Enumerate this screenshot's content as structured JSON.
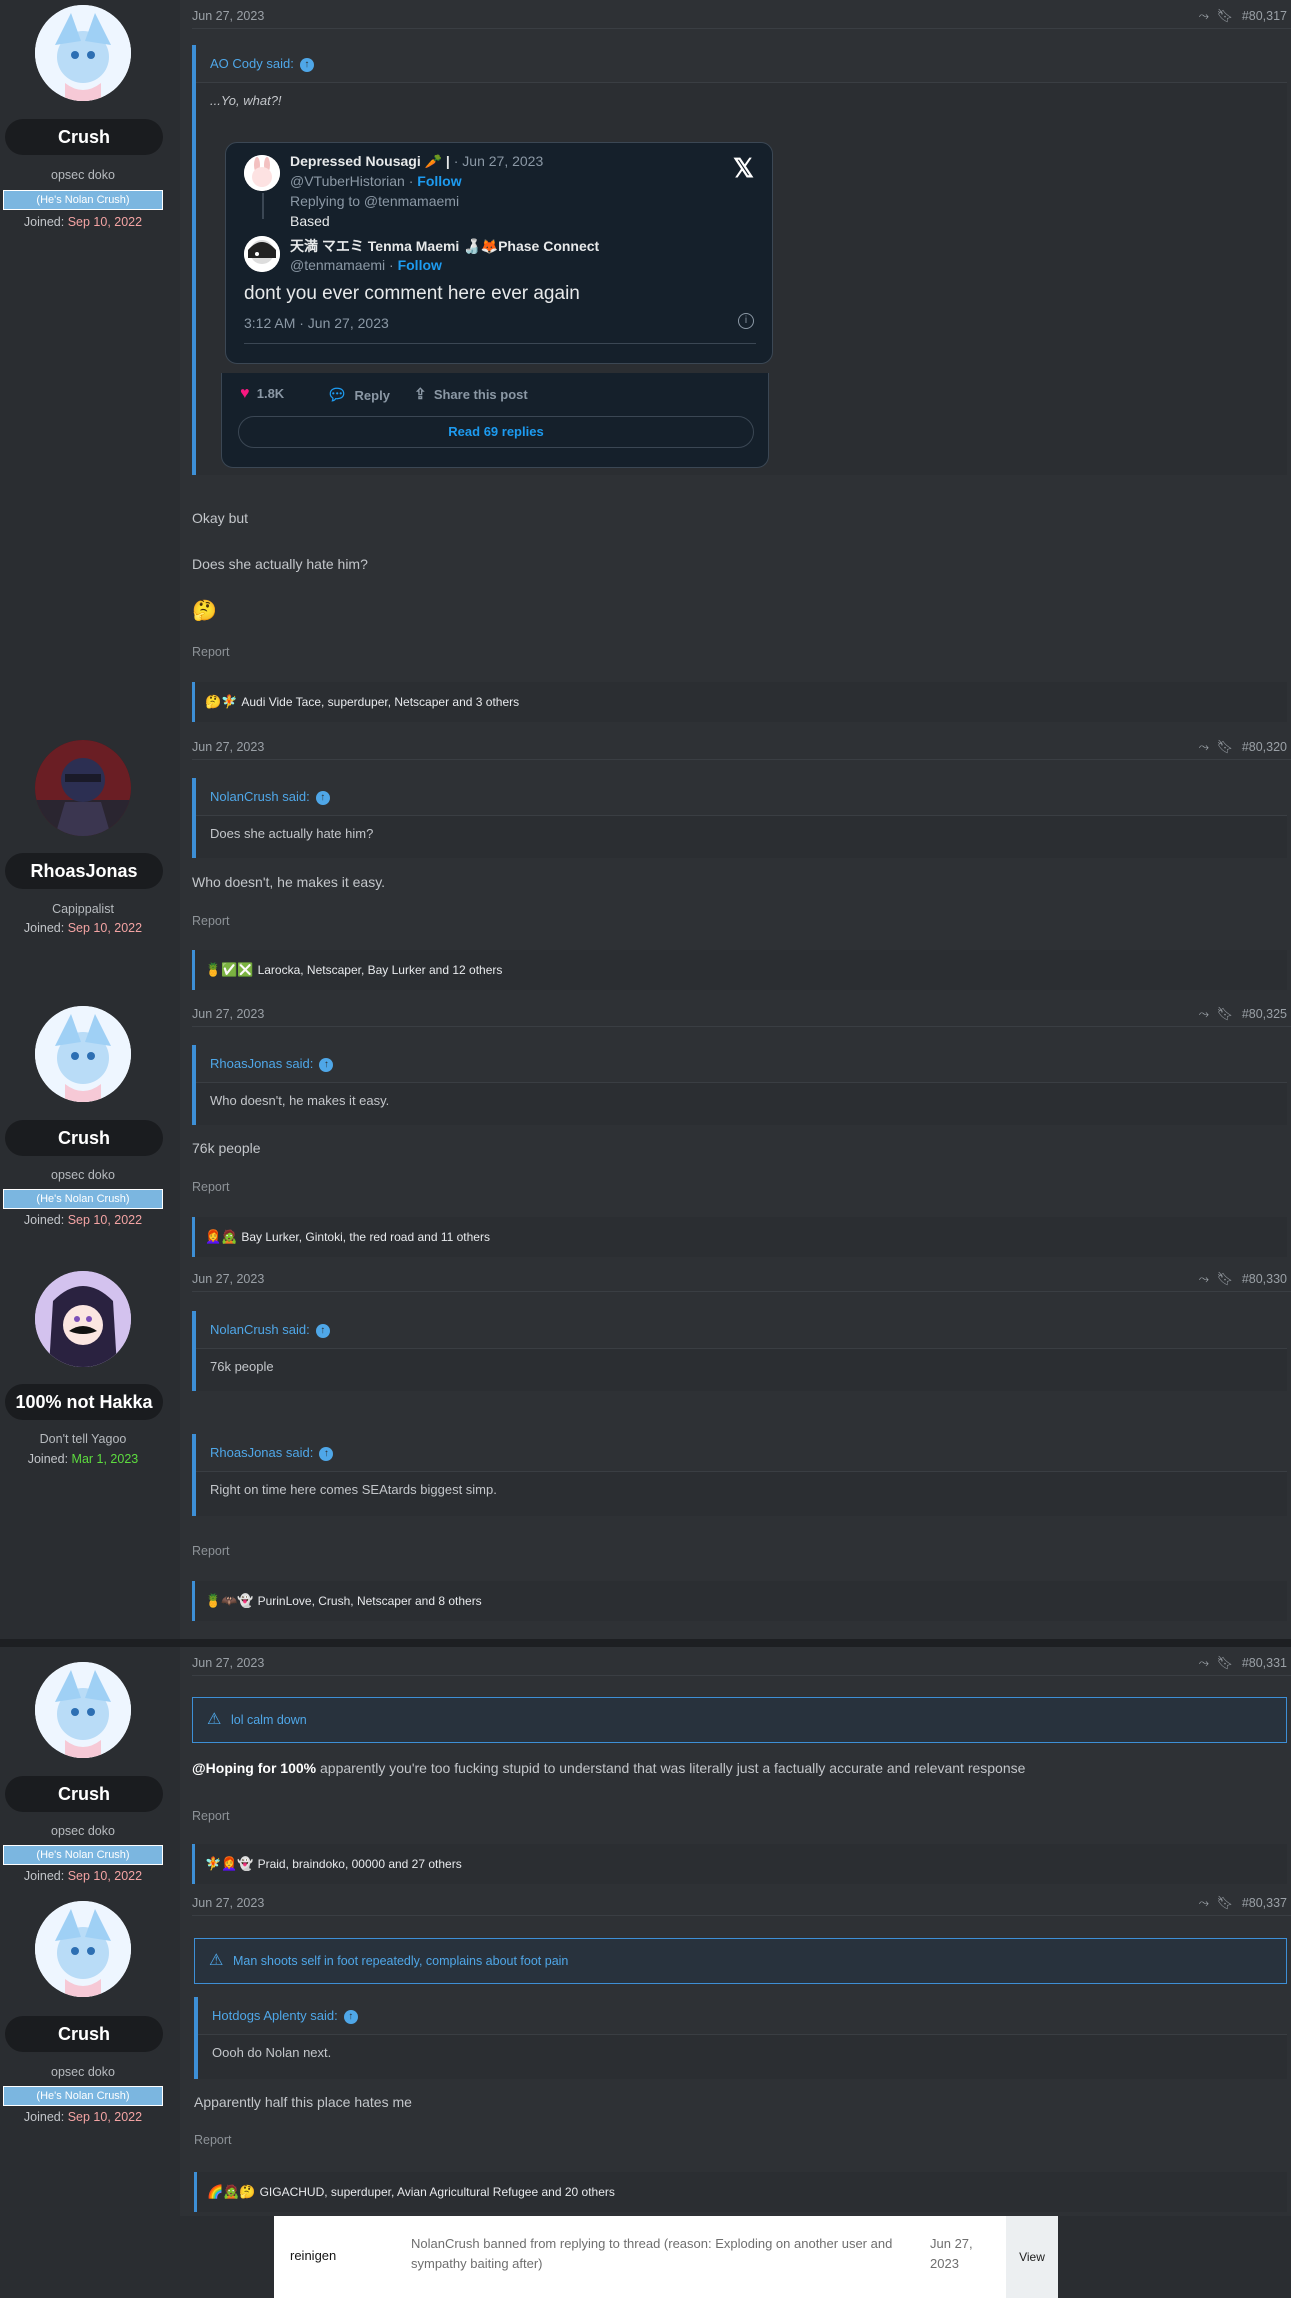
{
  "posts": [
    {
      "user": {
        "name": "Crush",
        "title": "opsec doko",
        "banner": "(He's Nolan Crush)",
        "joined_label": "Joined:",
        "joined": "Sep 10, 2022"
      },
      "date": "Jun 27, 2023",
      "number": "#80,317",
      "quote_author": "AO Cody said:",
      "quote_text": "...Yo, what?!",
      "tweet": {
        "name": "Depressed Nousagi 🥕 |",
        "date": "· Jun 27, 2023",
        "handle": "@VTuberHistorian ·",
        "follow": "Follow",
        "replying": "Replying to @tenmamaemi",
        "reply_text": "Based",
        "name2": "天満 マエミ Tenma Maemi 🍶🦊Phase Connect",
        "handle2": "@tenmamaemi ·",
        "main_text": "dont you ever comment here ever again",
        "time": "3:12 AM · Jun 27, 2023",
        "likes": "1.8K",
        "reply_label": "Reply",
        "share_label": "Share this post",
        "read_replies": "Read 69 replies"
      },
      "body": [
        "Okay but",
        "Does she actually hate him?",
        "🤔"
      ],
      "report": "Report",
      "reactions_emoji": "🤔🧚",
      "reactions": "Audi Vide Tace, superduper, Netscaper and 3 others"
    },
    {
      "user": {
        "name": "RhoasJonas",
        "title": "Capippalist",
        "joined_label": "Joined:",
        "joined": "Sep 10, 2022"
      },
      "date": "Jun 27, 2023",
      "number": "#80,320",
      "quote_author": "NolanCrush said:",
      "quote_text": "Does she actually hate him?",
      "body": "Who doesn't, he makes it easy.",
      "report": "Report",
      "reactions_emoji": "🍍✅❎",
      "reactions": "Larocka, Netscaper, Bay Lurker and 12 others"
    },
    {
      "user": {
        "name": "Crush",
        "title": "opsec doko",
        "banner": "(He's Nolan Crush)",
        "joined_label": "Joined:",
        "joined": "Sep 10, 2022"
      },
      "date": "Jun 27, 2023",
      "number": "#80,325",
      "quote_author": "RhoasJonas said:",
      "quote_text": "Who doesn't, he makes it easy.",
      "body": "76k people",
      "report": "Report",
      "reactions_emoji": "👩‍🦰🧟",
      "reactions": "Bay Lurker, Gintoki, the red road and 11 others"
    },
    {
      "user": {
        "name": "100% not Hakka",
        "title": "Don't tell Yagoo",
        "joined_label": "Joined:",
        "joined": "Mar 1, 2023"
      },
      "date": "Jun 27, 2023",
      "number": "#80,330",
      "quote_author": "NolanCrush said:",
      "quote_text": "76k people",
      "quote2_author": "RhoasJonas said:",
      "quote2_text": "Right on time here comes SEAtards biggest simp.",
      "report": "Report",
      "reactions_emoji": "🍍🦇👻",
      "reactions": "PurinLove, Crush, Netscaper and 8 others"
    },
    {
      "user": {
        "name": "Crush",
        "title": "opsec doko",
        "banner": "(He's Nolan Crush)",
        "joined_label": "Joined:",
        "joined": "Sep 10, 2022"
      },
      "date": "Jun 27, 2023",
      "number": "#80,331",
      "warning": "lol calm down",
      "mention": "@Hoping for 100%",
      "body": " apparently you're too fucking stupid to understand that was literally just a factually accurate and relevant response",
      "report": "Report",
      "reactions_emoji": "🧚👩‍🦰👻",
      "reactions": "Praid, braindoko, 00000 and 27 others"
    },
    {
      "user": {
        "name": "Crush",
        "title": "opsec doko",
        "banner": "(He's Nolan Crush)",
        "joined_label": "Joined:",
        "joined": "Sep 10, 2022"
      },
      "date": "Jun 27, 2023",
      "number": "#80,337",
      "warning": "Man shoots self in foot repeatedly, complains about foot pain",
      "quote_author": "Hotdogs Aplenty said:",
      "quote_text": "Oooh do Nolan next.",
      "body": "Apparently half this place hates me",
      "report": "Report",
      "reactions_emoji": "🌈🧟🤔",
      "reactions": "GIGACHUD, superduper, Avian Agricultural Refugee and 20 others"
    }
  ],
  "notification": {
    "user": "reinigen",
    "message": "NolanCrush banned from replying to thread (reason: Exploding on another user and sympathy baiting after)",
    "date": "Jun 27, 2023",
    "view": "View"
  },
  "icons": {
    "share": "share-icon",
    "bookmark": "bookmark-icon",
    "warning": "warning-icon",
    "x_logo": "x-logo-icon"
  }
}
